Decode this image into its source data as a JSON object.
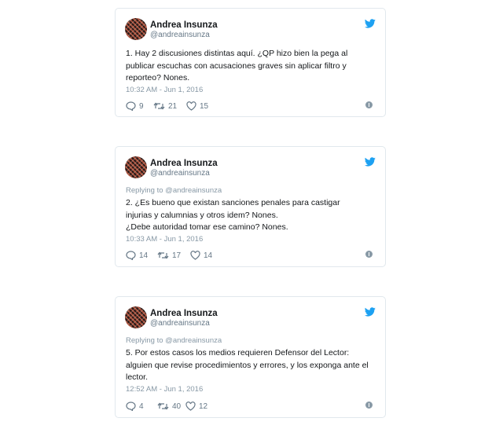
{
  "colors": {
    "twitter_blue": "#1da1f2",
    "text_primary": "#14171a",
    "text_secondary": "#657786",
    "border": "#e1e8ed"
  },
  "icons": {
    "brand": "twitter-bird-icon",
    "reply": "reply-icon",
    "retweet": "retweet-icon",
    "like": "heart-icon",
    "info": "info-icon"
  },
  "tweets": [
    {
      "author_name": "Andrea Insunza",
      "author_handle": "@andreainsunza",
      "replying_prefix": "",
      "replying_to": "",
      "lines": [
        "1. Hay 2 discusiones distintas aquí. ¿QP hizo bien la pega al",
        "publicar escuchas con acusaciones graves sin aplicar filtro y",
        "reporteo? Nones."
      ],
      "timestamp": "10:32 AM - Jun 1, 2016",
      "replies": "9",
      "retweets": "21",
      "likes": "15"
    },
    {
      "author_name": "Andrea Insunza",
      "author_handle": "@andreainsunza",
      "replying_prefix": "Replying to ",
      "replying_to": "@andreainsunza",
      "lines": [
        "2. ¿Es bueno que existan sanciones penales para castigar",
        "injurias y calumnias y otros idem? Nones.",
        "¿Debe autoridad tomar ese camino? Nones."
      ],
      "timestamp": "10:33 AM - Jun 1, 2016",
      "replies": "14",
      "retweets": "17",
      "likes": "14"
    },
    {
      "author_name": "Andrea Insunza",
      "author_handle": "@andreainsunza",
      "replying_prefix": "Replying to ",
      "replying_to": "@andreainsunza",
      "lines": [
        "5. Por estos casos los medios requieren Defensor del Lector:",
        "alguien que revise procedimientos y errores, y los exponga ante el",
        "lector."
      ],
      "timestamp": "12:52 AM - Jun 1, 2016",
      "replies": "4",
      "retweets": "40",
      "likes": "12"
    }
  ]
}
